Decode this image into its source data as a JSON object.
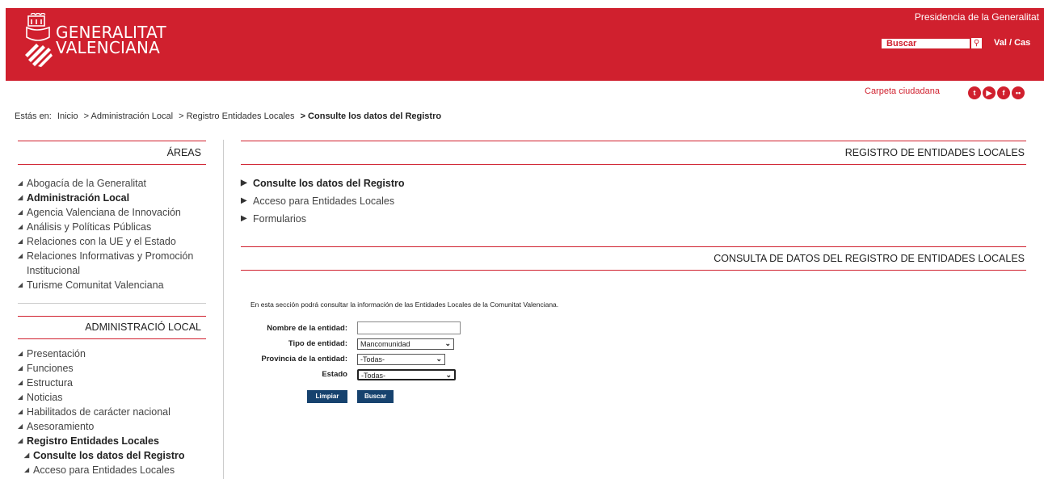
{
  "header": {
    "logo_line1": "GENERALITAT",
    "logo_line2": "VALENCIANA",
    "presidencia": "Presidencia de la Generalitat",
    "search_label": "Buscar",
    "search_icon": "magnifier-icon",
    "lang": "Val / Cas",
    "brand_color": "#d0202e"
  },
  "utility": {
    "carpeta": "Carpeta ciudadana",
    "social": [
      "twitter-icon",
      "youtube-icon",
      "facebook-icon",
      "flickr-icon"
    ]
  },
  "breadcrumb": {
    "prefix": "Estás en:",
    "items": [
      "Inicio",
      "> Administración Local",
      "> Registro Entidades Locales",
      "> Consulte los datos del Registro"
    ]
  },
  "sidebar": {
    "areas_title": "ÁREAS",
    "areas": [
      "Abogacía de la Generalitat",
      "Administración Local",
      "Agencia Valenciana de Innovación",
      "Análisis y Políticas Públicas",
      "Relaciones con la UE y el Estado",
      "Relaciones Informativas y Promoción Institucional",
      "Turisme Comunitat Valenciana"
    ],
    "admin_title": "ADMINISTRACIÓ LOCAL",
    "admin": [
      "Presentación",
      "Funciones",
      "Estructura",
      "Noticias",
      "Habilitados de carácter nacional",
      "Asesoramiento",
      "Registro Entidades Locales",
      "Consulte los datos del Registro",
      "Acceso para Entidades Locales"
    ]
  },
  "main": {
    "section_title": "REGISTRO DE ENTIDADES LOCALES",
    "links": [
      "Consulte los datos del Registro",
      "Acceso para Entidades Locales",
      "Formularios"
    ],
    "consulta_title": "CONSULTA DE DATOS DEL REGISTRO DE ENTIDADES LOCALES",
    "intro": "En esta sección podrá consultar la información de las Entidades Locales de la Comunitat Valenciana.",
    "form": {
      "nombre_label": "Nombre de la entidad:",
      "nombre_value": "",
      "tipo_label": "Tipo de entidad:",
      "tipo_value": "Mancomunidad",
      "provincia_label": "Provincia de la entidad:",
      "provincia_value": "-Todas-",
      "estado_label": "Estado",
      "estado_value": "-Todas-",
      "limpiar": "Limpiar",
      "buscar": "Buscar"
    }
  }
}
